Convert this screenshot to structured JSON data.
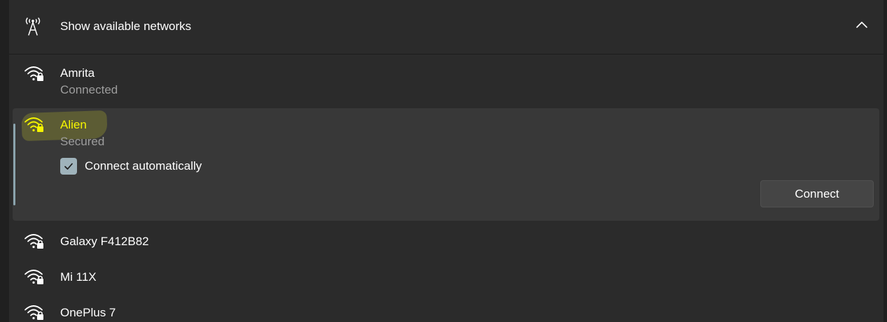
{
  "header": {
    "title": "Show available networks",
    "tower_icon": "network-tower-icon",
    "collapse_icon": "chevron-up-icon"
  },
  "networks": [
    {
      "name": "Amrita",
      "status": "Connected",
      "icon": "wifi-secured-icon"
    },
    {
      "name": "Alien",
      "status": "Secured",
      "icon": "wifi-secured-icon",
      "selected": true
    },
    {
      "name": "Galaxy F412B82",
      "status": "",
      "icon": "wifi-secured-icon"
    },
    {
      "name": "Mi 11X",
      "status": "",
      "icon": "wifi-secured-icon"
    },
    {
      "name": "OnePlus 7",
      "status": "",
      "icon": "wifi-secured-icon"
    }
  ],
  "selected_network": {
    "connect_automatically_label": "Connect automatically",
    "connect_automatically_checked": true,
    "connect_button_label": "Connect"
  },
  "colors": {
    "background": "#202020",
    "panel": "#2b2b2b",
    "selected_bg": "#383838",
    "highlight_text": "#f5f500",
    "secondary_text": "#9d9d9d",
    "checkbox": "#9fb3bb"
  }
}
